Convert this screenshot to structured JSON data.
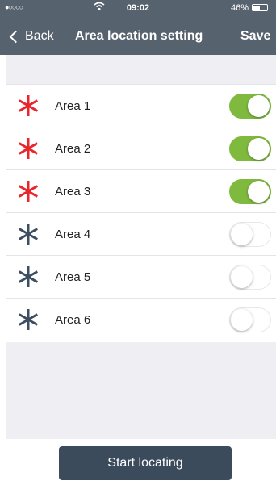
{
  "status_bar": {
    "signal": "●○○○○",
    "wifi": "wifi",
    "time": "09:02",
    "battery": "46%"
  },
  "nav": {
    "back_label": "Back",
    "title": "Area location setting",
    "save_label": "Save"
  },
  "areas": [
    {
      "label": "Area 1",
      "enabled": true,
      "icon": "asterisk-red-icon"
    },
    {
      "label": "Area 2",
      "enabled": true,
      "icon": "asterisk-red-icon"
    },
    {
      "label": "Area 3",
      "enabled": true,
      "icon": "asterisk-red-icon"
    },
    {
      "label": "Area 4",
      "enabled": false,
      "icon": "asterisk-blue-icon"
    },
    {
      "label": "Area 5",
      "enabled": false,
      "icon": "asterisk-blue-icon"
    },
    {
      "label": "Area 6",
      "enabled": false,
      "icon": "asterisk-blue-icon"
    }
  ],
  "start_button": "Start locating",
  "colors": {
    "header": "#57626f",
    "active_asterisk": "#e8262b",
    "inactive_asterisk": "#3d4e60",
    "toggle_on": "#7fba3f",
    "button": "#3c4b5c"
  }
}
